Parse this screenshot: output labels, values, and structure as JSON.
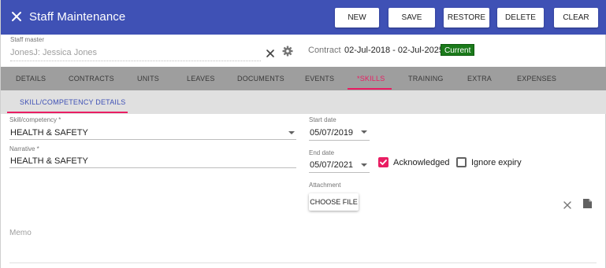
{
  "header": {
    "title": "Staff Maintenance",
    "buttons": {
      "new": "NEW",
      "save": "SAVE",
      "restore": "RESTORE",
      "delete": "DELETE",
      "clear": "CLEAR"
    }
  },
  "staff": {
    "label": "Staff master",
    "value": "JonesJ: Jessica Jones",
    "contract_label": "Contract",
    "contract_dates": "02-Jul-2018 - 02-Jul-2025",
    "status_badge": "Current"
  },
  "tabs": [
    "DETAILS",
    "CONTRACTS",
    "UNITS",
    "LEAVES",
    "DOCUMENTS",
    "EVENTS",
    "*SKILLS",
    "TRAINING",
    "EXTRA",
    "EXPENSES"
  ],
  "active_tab": "*SKILLS",
  "subtab": "SKILL/COMPETENCY DETAILS",
  "form": {
    "skill_label": "Skill/competency *",
    "skill_value": "HEALTH & SAFETY",
    "narrative_label": "Narrative *",
    "narrative_value": "HEALTH & SAFETY",
    "start_label": "Start date",
    "start_value": "05/07/2019",
    "end_label": "End date",
    "end_value": "05/07/2021",
    "acknowledged_label": "Acknowledged",
    "acknowledged": true,
    "ignore_expiry_label": "Ignore expiry",
    "ignore_expiry": false,
    "attachment_label": "Attachment",
    "choose_file": "CHOOSE FILE",
    "memo_label": "Memo"
  },
  "colors": {
    "header_bg": "#3f51b5",
    "accent": "#e91e63",
    "badge_green": "#1b7a1b",
    "tab_bar": "#9e9e9e",
    "subtab_bar": "#e0e0e0"
  },
  "icons": [
    "close-icon",
    "clear-icon",
    "gear-icon",
    "checkbox-checked-icon",
    "checkbox-empty-icon",
    "file-icon"
  ]
}
